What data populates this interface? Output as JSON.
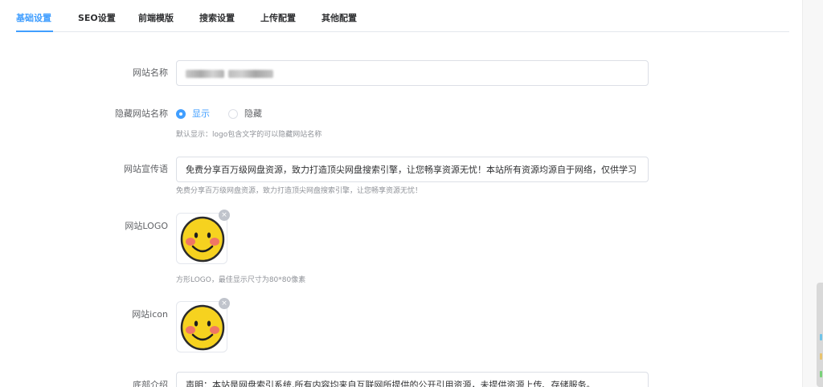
{
  "tabs": [
    {
      "label": "基础设置",
      "active": true
    },
    {
      "label": "SEO设置",
      "active": false
    },
    {
      "label": "前端模版",
      "active": false
    },
    {
      "label": "搜索设置",
      "active": false
    },
    {
      "label": "上传配置",
      "active": false
    },
    {
      "label": "其他配置",
      "active": false
    }
  ],
  "form": {
    "site_name": {
      "label": "网站名称",
      "value": ""
    },
    "hide_name": {
      "label": "隐藏网站名称",
      "options": [
        {
          "label": "显示",
          "checked": true
        },
        {
          "label": "隐藏",
          "checked": false
        }
      ],
      "hint": "默认显示：logo包含文字的可以隐藏网站名称"
    },
    "slogan": {
      "label": "网站宣传语",
      "value": "免费分享百万级网盘资源，致力打造顶尖网盘搜索引擎，让您畅享资源无忧！本站所有资源均源自于网络，仅供学习",
      "hint": "免费分享百万级网盘资源，致力打造顶尖网盘搜索引擎，让您畅享资源无忧！"
    },
    "logo": {
      "label": "网站LOGO",
      "hint": "方形LOGO，最佳显示尺寸为80*80像素",
      "delete_glyph": "×"
    },
    "icon": {
      "label": "网站icon",
      "delete_glyph": "×"
    },
    "footer": {
      "label": "底部介绍",
      "value": "声明：本站是网盘索引系统,所有内容均来自互联网所提供的公开引用资源，未提供资源上传、存储服务。"
    }
  },
  "colors": {
    "accent": "#409eff",
    "border": "#dcdfe6",
    "hint": "#909399"
  },
  "icons": {
    "logo_image": "smiley-face-icon",
    "remove": "close-circle-icon"
  }
}
